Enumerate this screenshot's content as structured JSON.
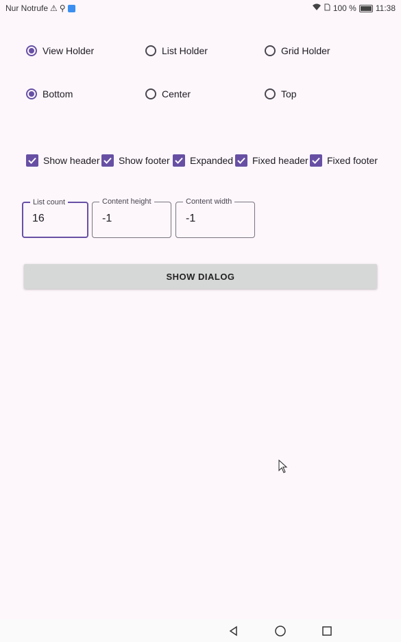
{
  "status_bar": {
    "carrier": "Nur Notrufe",
    "battery_percent": "100 %",
    "time": "11:38",
    "icons": [
      "warning-icon",
      "usb-icon",
      "app-icon",
      "wifi-icon",
      "sim-icon",
      "battery-icon"
    ]
  },
  "holder_options": {
    "selected": "View Holder",
    "items": [
      "View Holder",
      "List Holder",
      "Grid Holder"
    ]
  },
  "gravity_options": {
    "selected": "Bottom",
    "items": [
      "Bottom",
      "Center",
      "Top"
    ]
  },
  "toggles": [
    {
      "label": "Show header",
      "checked": true
    },
    {
      "label": "Show footer",
      "checked": true
    },
    {
      "label": "Expanded",
      "checked": true
    },
    {
      "label": "Fixed header",
      "checked": true
    },
    {
      "label": "Fixed footer",
      "checked": true
    }
  ],
  "fields": {
    "list_count": {
      "label": "List count",
      "value": "16"
    },
    "content_height": {
      "label": "Content height",
      "value": "-1"
    },
    "content_width": {
      "label": "Content width",
      "value": "-1"
    }
  },
  "actions": {
    "show_dialog": "SHOW DIALOG"
  },
  "colors": {
    "accent": "#6750a4",
    "background": "#fdf7fc",
    "button": "#d6d7d7"
  }
}
